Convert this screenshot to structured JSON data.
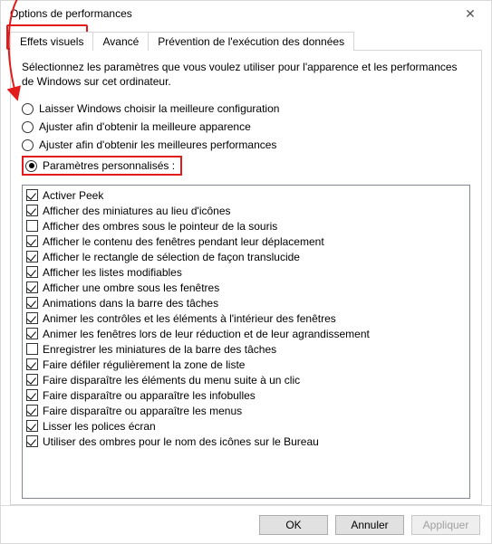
{
  "window": {
    "title": "Options de performances"
  },
  "tabs": {
    "visual": "Effets visuels",
    "advanced": "Avancé",
    "dep": "Prévention de l'exécution des données"
  },
  "intro": "Sélectionnez les paramètres que vous voulez utiliser pour l'apparence et les performances de Windows sur cet ordinateur.",
  "radios": {
    "let_windows": "Laisser Windows choisir la meilleure configuration",
    "best_appearance": "Ajuster afin d'obtenir la meilleure apparence",
    "best_performance": "Ajuster afin d'obtenir les meilleures performances",
    "custom": "Paramètres personnalisés :"
  },
  "options": [
    {
      "checked": true,
      "label": "Activer Peek"
    },
    {
      "checked": true,
      "label": "Afficher des miniatures au lieu d'icônes"
    },
    {
      "checked": false,
      "label": "Afficher des ombres sous le pointeur de la souris"
    },
    {
      "checked": true,
      "label": "Afficher le contenu des fenêtres pendant leur déplacement"
    },
    {
      "checked": true,
      "label": "Afficher le rectangle de sélection de façon translucide"
    },
    {
      "checked": true,
      "label": "Afficher les listes modifiables"
    },
    {
      "checked": true,
      "label": "Afficher une ombre sous les fenêtres"
    },
    {
      "checked": true,
      "label": "Animations dans la barre des tâches"
    },
    {
      "checked": true,
      "label": "Animer les contrôles et les éléments à l'intérieur des fenêtres"
    },
    {
      "checked": true,
      "label": "Animer les fenêtres lors de leur réduction et de leur agrandissement"
    },
    {
      "checked": false,
      "label": "Enregistrer les miniatures de la barre des tâches"
    },
    {
      "checked": true,
      "label": "Faire défiler régulièrement la zone de liste"
    },
    {
      "checked": true,
      "label": "Faire disparaître les éléments du menu suite à un clic"
    },
    {
      "checked": true,
      "label": "Faire disparaître ou apparaître les infobulles"
    },
    {
      "checked": true,
      "label": "Faire disparaître ou apparaître les menus"
    },
    {
      "checked": true,
      "label": "Lisser les polices écran"
    },
    {
      "checked": true,
      "label": "Utiliser des ombres pour le nom des icônes sur le Bureau"
    }
  ],
  "buttons": {
    "ok": "OK",
    "cancel": "Annuler",
    "apply": "Appliquer"
  }
}
